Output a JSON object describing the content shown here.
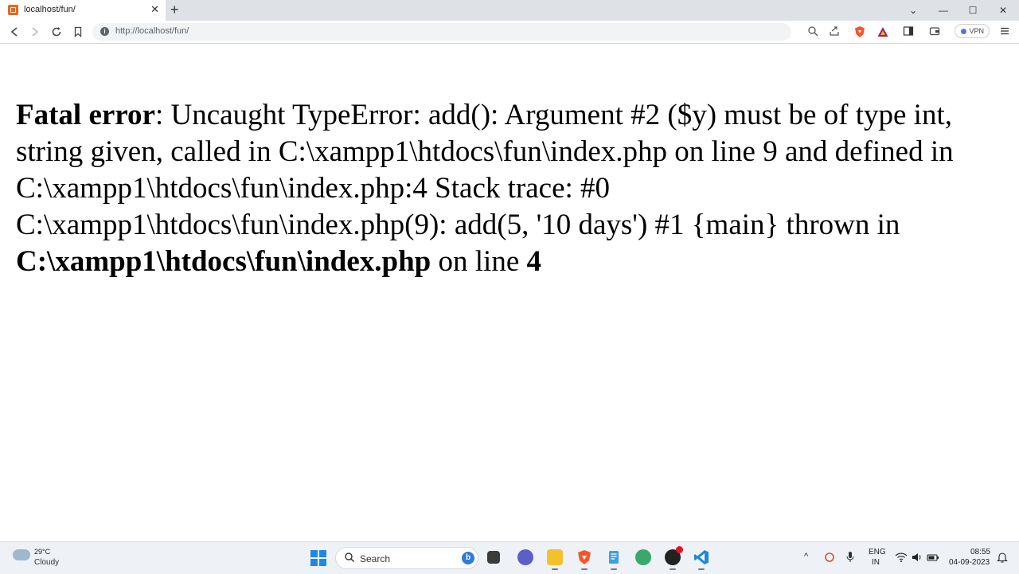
{
  "browser": {
    "tab_title": "localhost/fun/",
    "tab_close": "✕",
    "new_tab": "+",
    "url": "http://localhost/fun/",
    "vpn_label": "VPN",
    "window_controls": {
      "dropdown": "⌄",
      "minimize": "—",
      "maximize": "☐",
      "close": "✕"
    }
  },
  "page": {
    "error_label": "Fatal error",
    "message": ": Uncaught TypeError: add(): Argument #2 ($y) must be of type int, string given, called in C:\\xampp1\\htdocs\\fun\\index.php on line 9 and defined in C:\\xampp1\\htdocs\\fun\\index.php:4 Stack trace: #0 C:\\xampp1\\htdocs\\fun\\index.php(9): add(5, '10 days') #1 {main} thrown in ",
    "file_path": "C:\\xampp1\\htdocs\\fun\\index.php",
    "on_line_text": " on line ",
    "line_number": "4"
  },
  "taskbar": {
    "weather_temp": "29°C",
    "weather_desc": "Cloudy",
    "search_label": "Search",
    "language_top": "ENG",
    "language_bottom": "IN",
    "time": "08:55",
    "date": "04-09-2023"
  },
  "colors": {
    "tab_strip": "#dee1e6",
    "accent_brave": "#fb542b",
    "windows_blue": "#1e88e5"
  }
}
